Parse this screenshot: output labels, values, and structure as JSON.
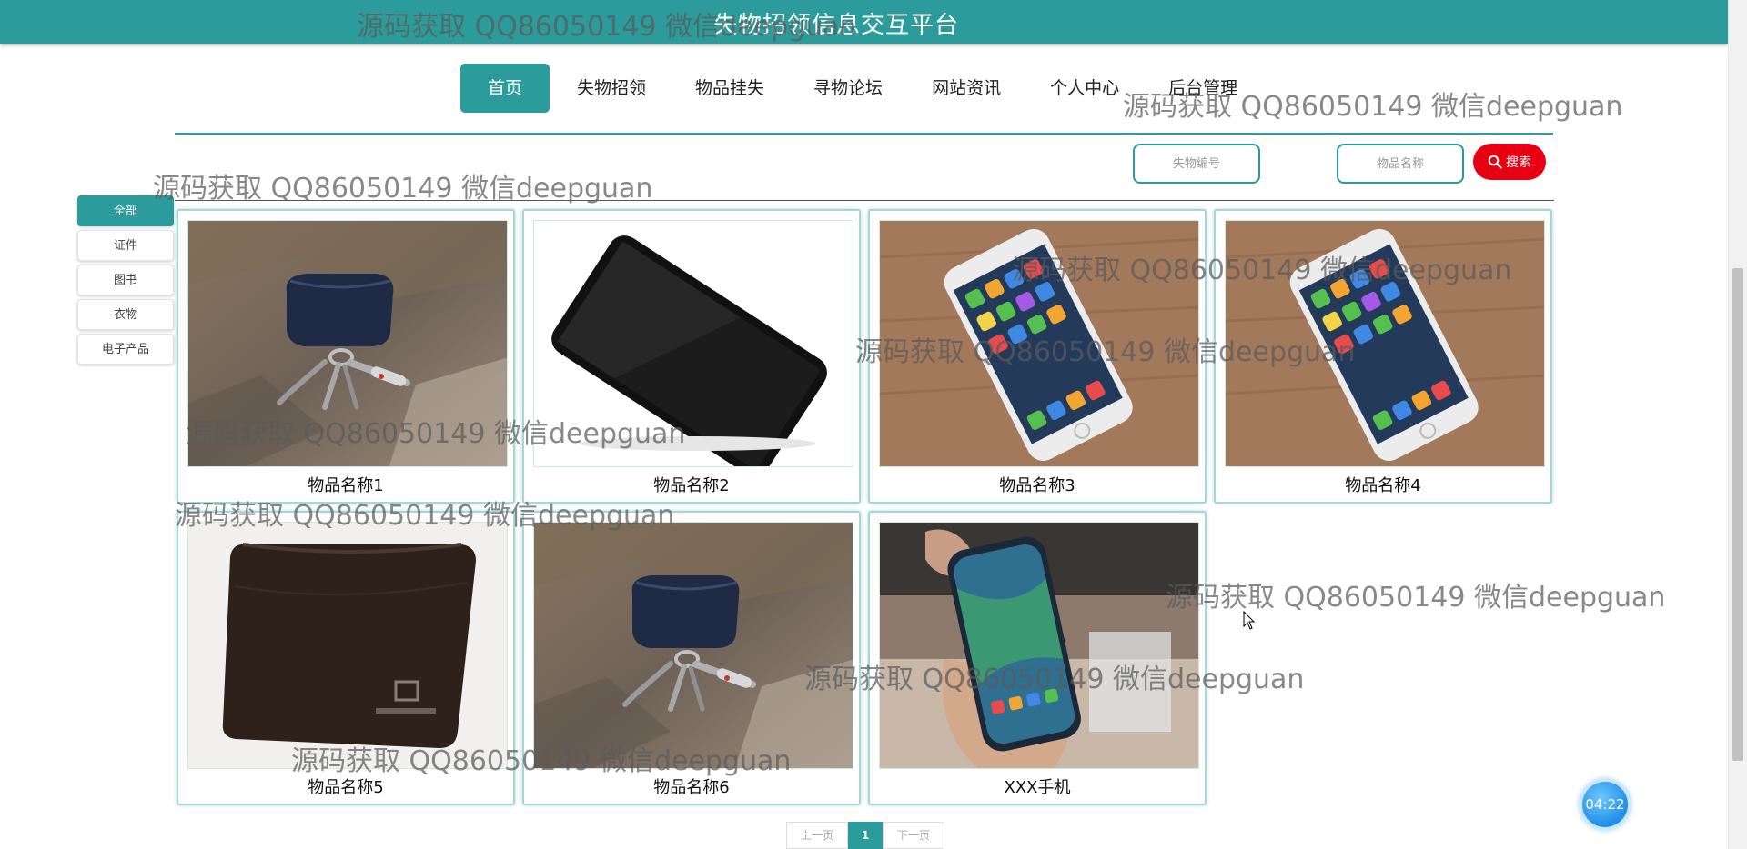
{
  "header": {
    "site_title": "失物招领信息交互平台"
  },
  "nav": {
    "items": [
      {
        "label": "首页",
        "active": true
      },
      {
        "label": "失物招领"
      },
      {
        "label": "物品挂失"
      },
      {
        "label": "寻物论坛"
      },
      {
        "label": "网站资讯"
      },
      {
        "label": "个人中心"
      },
      {
        "label": "后台管理"
      }
    ]
  },
  "search": {
    "code_placeholder": "失物编号",
    "name_placeholder": "物品名称",
    "button_label": "搜索"
  },
  "categories": [
    {
      "label": "全部",
      "active": true
    },
    {
      "label": "证件"
    },
    {
      "label": "图书"
    },
    {
      "label": "衣物"
    },
    {
      "label": "电子产品"
    }
  ],
  "products": [
    {
      "name": "物品名称1",
      "image": "keys-pouch"
    },
    {
      "name": "物品名称2",
      "image": "black-phone"
    },
    {
      "name": "物品名称3",
      "image": "iphone-on-wood"
    },
    {
      "name": "物品名称4",
      "image": "iphone-on-wood"
    },
    {
      "name": "物品名称5",
      "image": "leather-wallet"
    },
    {
      "name": "物品名称6",
      "image": "keys-pouch"
    },
    {
      "name": "XXX手机",
      "image": "phone-in-hand"
    }
  ],
  "pagination": {
    "prev_label": "上一页",
    "current": "1",
    "next_label": "下一页"
  },
  "timer": {
    "text": "04:22"
  },
  "watermark": {
    "text": "源码获取 QQ86050149 微信deepguan"
  },
  "colors": {
    "brand": "#2b9b9b",
    "search_button": "#e60012",
    "timer": "#1f8fe8"
  }
}
